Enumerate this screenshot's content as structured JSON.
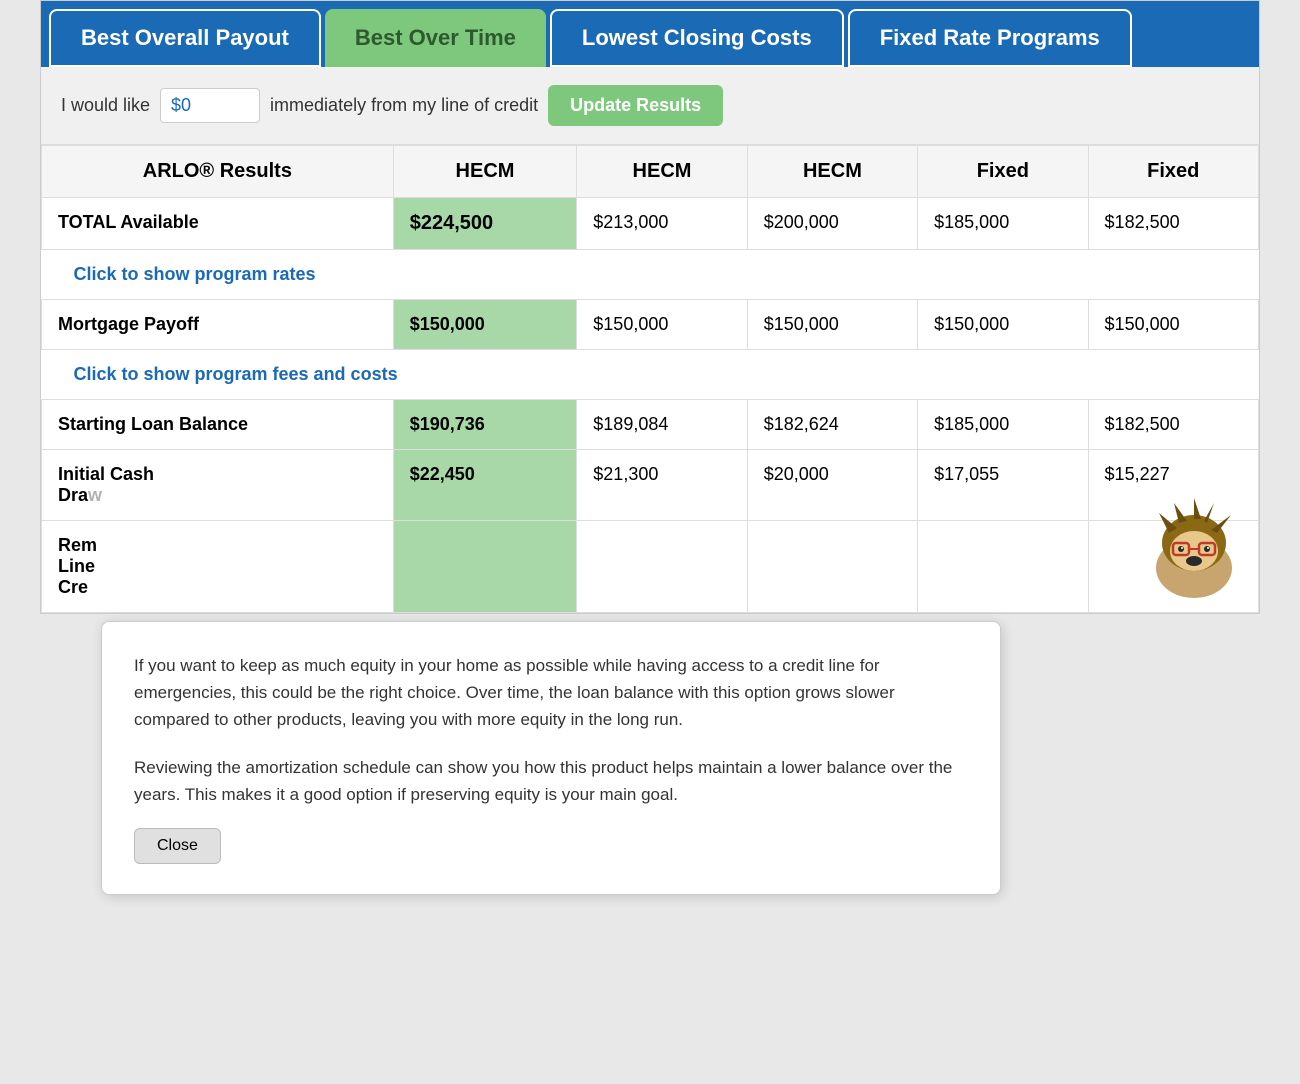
{
  "tabs": [
    {
      "id": "best-overall",
      "label": "Best Overall Payout",
      "style": "active-blue"
    },
    {
      "id": "best-over-time",
      "label": "Best Over Time",
      "style": "active-green"
    },
    {
      "id": "lowest-closing",
      "label": "Lowest Closing Costs",
      "style": "active-blue"
    },
    {
      "id": "fixed-rate",
      "label": "Fixed Rate Programs",
      "style": "active-blue"
    }
  ],
  "credit_bar": {
    "prefix": "I would like",
    "input_value": "$0",
    "suffix": "immediately from my line of credit",
    "button_label": "Update Results"
  },
  "table": {
    "headers": [
      "ARLO® Results",
      "HECM",
      "HECM",
      "HECM",
      "Fixed",
      "Fixed"
    ],
    "rows": [
      {
        "type": "data",
        "label": "TOTAL Available",
        "values": [
          "$224,500",
          "$213,000",
          "$200,000",
          "$185,000",
          "$182,500"
        ]
      },
      {
        "type": "link",
        "text": "Click to show program rates"
      },
      {
        "type": "data",
        "label": "Mortgage Payoff",
        "values": [
          "$150,000",
          "$150,000",
          "$150,000",
          "$150,000",
          "$150,000"
        ]
      },
      {
        "type": "link",
        "text": "Click to show program fees and costs"
      },
      {
        "type": "data",
        "label": "Starting Loan Balance",
        "values": [
          "$190,736",
          "$189,084",
          "$182,624",
          "$185,000",
          "$182,500"
        ]
      },
      {
        "type": "partial",
        "label": "Initial Cash Dra...",
        "values": [
          "$22,450",
          "$21,300",
          "$20,000",
          "$17,055",
          "$15,227"
        ]
      },
      {
        "type": "partial",
        "label": "Rem... Line Cre...",
        "values": [
          "",
          "",
          "",
          "",
          ""
        ]
      }
    ]
  },
  "tooltip": {
    "paragraph1": "If you want to keep as much equity in your home as possible while having access to a credit line for emergencies, this could be the right choice. Over time, the loan balance with this option grows slower compared to other products, leaving you with more equity in the long run.",
    "paragraph2": "Reviewing the amortization schedule can show you how this product helps maintain a lower balance over the years. This makes it a good option if preserving equity is your main goal.",
    "close_label": "Close"
  }
}
